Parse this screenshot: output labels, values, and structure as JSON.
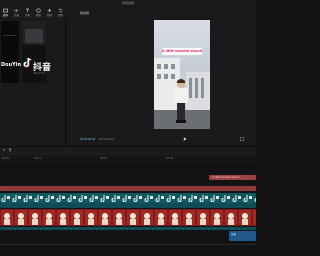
{
  "window": {
    "title": "抖音剪辑"
  },
  "toolbar": {
    "items": [
      {
        "label": "媒体",
        "icon": "media-icon"
      },
      {
        "label": "音频",
        "icon": "audio-icon"
      },
      {
        "label": "文本",
        "icon": "text-icon"
      },
      {
        "label": "贴纸",
        "icon": "sticker-icon"
      },
      {
        "label": "特效",
        "icon": "effects-icon"
      },
      {
        "label": "转场",
        "icon": "transition-icon"
      }
    ]
  },
  "media": {
    "items": [
      {
        "brand_text": "DouYin"
      },
      {
        "brand_cn": "抖音",
        "brand_sub": "DouYin"
      }
    ]
  },
  "player": {
    "label": "播放器",
    "caption": "A little bookish slouch",
    "current_time": "00:00:00:00",
    "duration": "00:00:05:12"
  },
  "timeline": {
    "ruler": [
      "00:00",
      "00:10",
      "00:20",
      "00:30"
    ],
    "text_clip": "A little bookish slouch",
    "audio_clip": "音频"
  },
  "colors": {
    "accent": "#7ec8ff",
    "caption_text": "#e2285b",
    "text_track": "#9b4242",
    "sticker_track": "#115f66",
    "video_track": "#6a1818",
    "audio_track": "#1f5a8a"
  }
}
